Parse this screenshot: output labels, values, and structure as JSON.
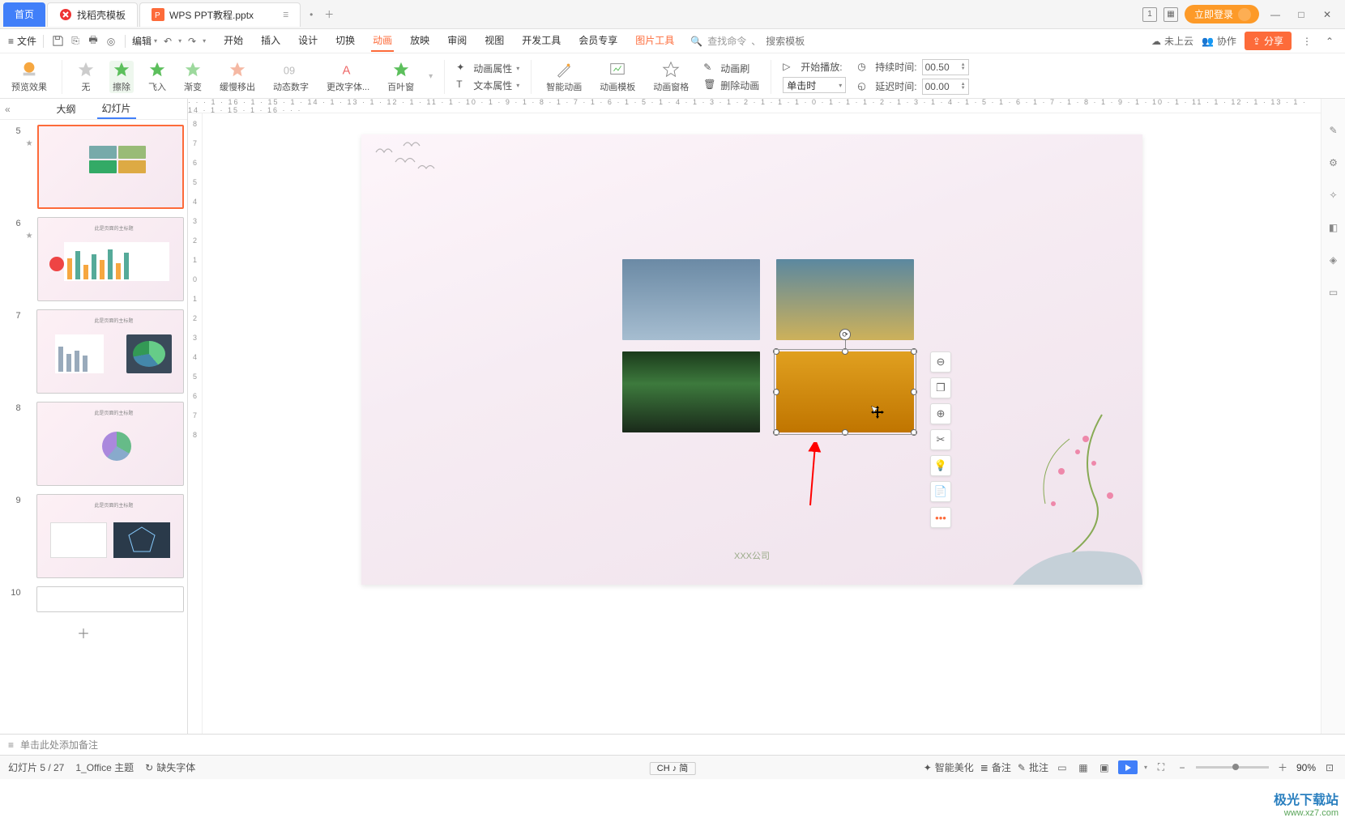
{
  "tabs": {
    "home": "首页",
    "templates": "找稻壳模板",
    "file": "WPS PPT教程.pptx"
  },
  "topbar": {
    "login": "立即登录"
  },
  "menu": {
    "file": "文件",
    "edit": "编辑",
    "items": {
      "start": "开始",
      "insert": "插入",
      "design": "设计",
      "transition": "切换",
      "anim": "动画",
      "show": "放映",
      "review": "审阅",
      "view": "视图",
      "dev": "开发工具",
      "member": "会员专享",
      "pic": "图片工具"
    },
    "search_hint": "查找命令",
    "search_placeholder": "搜索模板",
    "cloud": "未上云",
    "coop": "协作",
    "share": "分享"
  },
  "ribbon": {
    "preview": "预览效果",
    "effects": {
      "none": "无",
      "wipe": "擦除",
      "flyin": "飞入",
      "fade": "渐变",
      "slowmove": "缓慢移出",
      "dyn": "动态数字",
      "font": "更改字体...",
      "shutter": "百叶窗"
    },
    "anim_prop": "动画属性",
    "text_prop": "文本属性",
    "smart": "智能动画",
    "template": "动画模板",
    "pane": "动画窗格",
    "brush": "动画刷",
    "del": "删除动画",
    "start_play": "开始播放:",
    "select_val": "单击时",
    "duration": "持续时间:",
    "duration_val": "00.50",
    "delay": "延迟时间:",
    "delay_val": "00.00"
  },
  "panel": {
    "outline": "大纲",
    "slides": "幻灯片",
    "thumb_numbers": [
      "5",
      "6",
      "7",
      "8",
      "9",
      "10"
    ]
  },
  "ruler_h": "· · · 1 · 16 · 1 · 15 · 1 · 14 · 1 · 13 · 1 · 12 · 1 · 11 · 1 · 10 · 1 · 9 · 1 · 8 · 1 · 7 · 1 · 6 · 1 · 5 · 1 · 4 · 1 · 3 · 1 · 2 · 1 · 1 · 1 · 0 · 1 · 1 · 1 · 2 · 1 · 3 · 1 · 4 · 1 · 5 · 1 · 6 · 1 · 7 · 1 · 8 · 1 · 9 · 1 · 10 · 1 · 11 · 1 · 12 · 1 · 13 · 1 · 14 · 1 · 15 · 1 · 16 · · ·",
  "slide": {
    "company": "XXX公司"
  },
  "notes": {
    "placeholder": "单击此处添加备注"
  },
  "status": {
    "slide": "幻灯片 5 / 27",
    "theme": "1_Office 主题",
    "missing": "缺失字体",
    "ime": "CH ♪ 简",
    "beautify": "智能美化",
    "notes": "备注",
    "comments": "批注",
    "zoom": "90%"
  },
  "watermark": {
    "site": "极光下载站",
    "url": "www.xz7.com"
  }
}
